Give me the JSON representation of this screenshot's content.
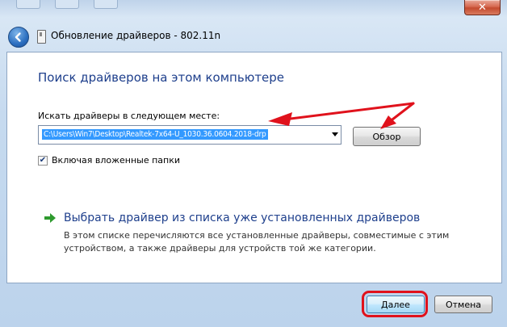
{
  "window": {
    "title": "Обновление драйверов - 802.11n",
    "close_glyph": "✕"
  },
  "content": {
    "heading": "Поиск драйверов на этом компьютере",
    "search_label": "Искать драйверы в следующем месте:",
    "path_value": "C:\\Users\\Win7\\Desktop\\Realtek-7x64-U_1030.36.0604.2018-drp",
    "browse_label": "Обзор",
    "include_subfolders_label": "Включая вложенные папки",
    "include_subfolders_checked": true,
    "check_glyph": "✔",
    "pick_link": "Выбрать драйвер из списка уже установленных драйверов",
    "pick_description": "В этом списке перечисляются все установленные драйверы, совместимые с этим устройством, а также драйверы для устройств той же категории."
  },
  "footer": {
    "next_label": "Далее",
    "cancel_label": "Отмена"
  },
  "icons": {
    "back": "back-arrow-icon",
    "device": "device-icon",
    "pick": "green-arrow-icon"
  },
  "colors": {
    "heading": "#1e3f8c",
    "selection": "#3399ff",
    "annotation": "#e0121c",
    "pick_arrow": "#2e9a2e"
  }
}
